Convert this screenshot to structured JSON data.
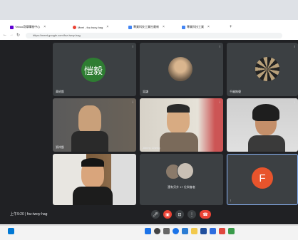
{
  "browser": {
    "tabs": [
      {
        "label": "Yahoo奇摩購物中心",
        "color": "#6001d2"
      },
      {
        "label": "Meet - foz-twoy-hag",
        "color": "#ea4335"
      },
      {
        "label": "專業科技工業社最新",
        "color": "#4285f4"
      },
      {
        "label": "專業科技工業",
        "color": "#4285f4"
      }
    ],
    "new_tab": "+",
    "url": "https://meet.google.com/foz-twoy-hag"
  },
  "meet": {
    "tiles": [
      {
        "name": "黃紹凱",
        "avatar_text": "愷毅",
        "avatar_color": "#2e7d32"
      },
      {
        "name": "吳謙",
        "avatar_text": "",
        "avatar_color": "#7a6a58"
      },
      {
        "name": "千幽無聲",
        "avatar_text": "",
        "avatar_color": "#555"
      },
      {
        "name": "張祥凱",
        "avatar_text": "",
        "avatar_color": ""
      },
      {
        "name": "Jimmy Cheng",
        "avatar_text": "",
        "avatar_color": ""
      },
      {
        "name": "",
        "avatar_text": "",
        "avatar_color": ""
      },
      {
        "name": "",
        "avatar_text": "",
        "avatar_color": ""
      },
      {
        "name": "還有另外 17 位與會者",
        "avatar_text": "",
        "avatar_color": ""
      },
      {
        "name": "",
        "avatar_text": "F",
        "avatar_color": "#e8542c"
      }
    ],
    "time": "上午9:20",
    "meeting_code": "foz-twoy-hag"
  },
  "colors": {
    "meet_bg": "#202124",
    "tile_bg": "#3c4043",
    "leave_red": "#ea4335"
  }
}
